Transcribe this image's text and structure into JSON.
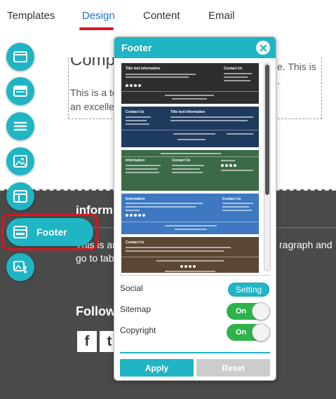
{
  "tabs": [
    {
      "label": "Templates"
    },
    {
      "label": "Design"
    },
    {
      "label": "Content"
    },
    {
      "label": "Email"
    }
  ],
  "canvas": {
    "heading_partial": "Comp",
    "para_line1_left": "This is a te",
    "para_line1_right": "e. This is",
    "para_line2_left": "an excelle",
    "para_line2_right": "."
  },
  "footer_section": {
    "info_title": "inform",
    "info_text_line1": "This is an",
    "info_text_line1_right": "ragraph and",
    "info_text_line2": "go to tab",
    "follow_title": "Follow",
    "social": [
      "f",
      "t"
    ]
  },
  "sidebar": {
    "items": [
      {
        "icon": "window-icon"
      },
      {
        "icon": "header-icon"
      },
      {
        "icon": "menu-icon"
      },
      {
        "icon": "image-icon"
      },
      {
        "icon": "layout-icon"
      },
      {
        "icon": "footer-icon",
        "label": "Footer"
      },
      {
        "icon": "image-settings-icon"
      }
    ]
  },
  "panel": {
    "title": "Footer",
    "templates": [
      {
        "color": "#2e2e2e",
        "heading": "Title text information",
        "contact": "Contact Us"
      },
      {
        "color": "#1f3a5f",
        "heading": "Title text information",
        "contact": "Contact Us"
      },
      {
        "color": "#3a6b46",
        "heading": "Information",
        "contact": "Contact Us"
      },
      {
        "color": "#3d78c0",
        "heading": "Information",
        "contact": "Contact Us"
      },
      {
        "color": "#5b4633",
        "heading": "Contact Us",
        "contact": ""
      }
    ],
    "options": {
      "social_label": "Social",
      "setting_label": "Setting",
      "sitemap_label": "Sitemap",
      "sitemap_state": "On",
      "copyright_label": "Copyright",
      "copyright_state": "On"
    },
    "apply_label": "Apply",
    "reset_label": "Reset"
  },
  "colors": {
    "accent": "#1fb5c4",
    "highlight": "#e0121d",
    "toggle_on": "#2eb34a",
    "active_tab": "#1976d2"
  }
}
